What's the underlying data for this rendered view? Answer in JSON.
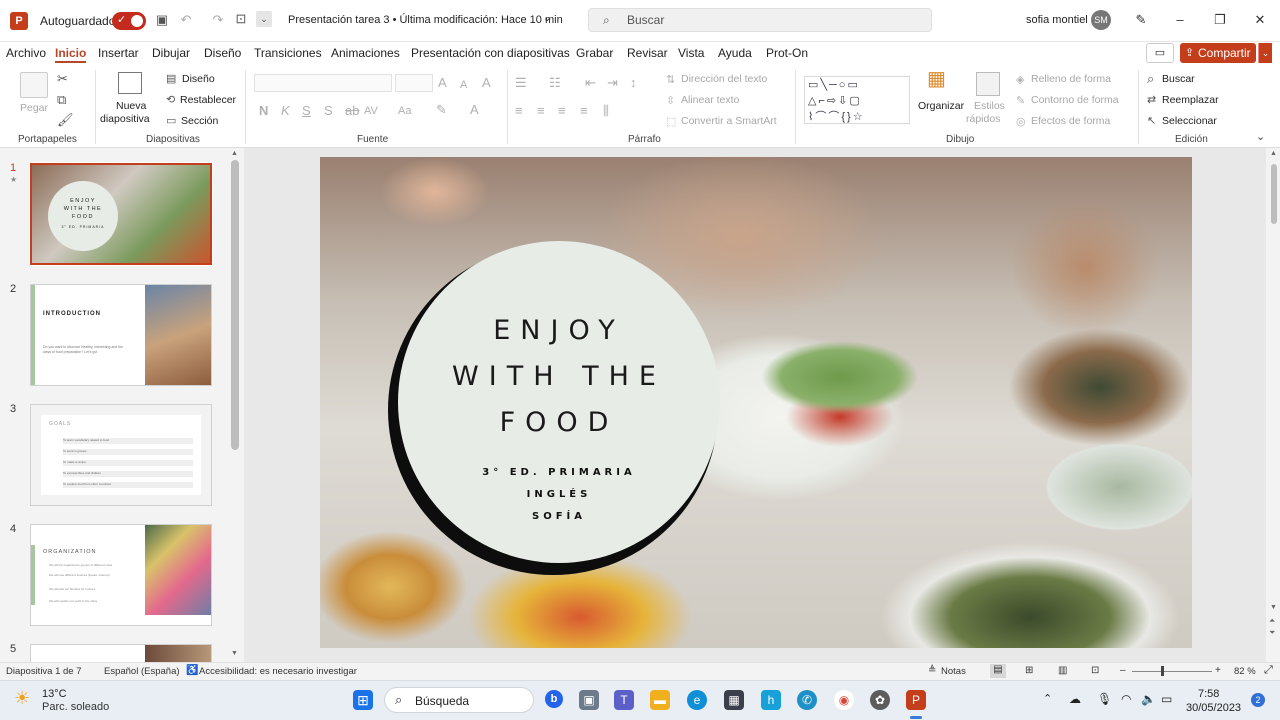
{
  "titlebar": {
    "autosave_label": "Autoguardado",
    "doc_title": "Presentación tarea 3 • Última modificación: Hace 10 min",
    "search_placeholder": "Buscar",
    "user_name": "sofia montiel",
    "user_initials": "SM"
  },
  "menu": {
    "tabs": [
      "Archivo",
      "Inicio",
      "Insertar",
      "Dibujar",
      "Diseño",
      "Transiciones",
      "Animaciones",
      "Presentación con diapositivas",
      "Grabar",
      "Revisar",
      "Vista",
      "Ayuda",
      "Prot-On"
    ],
    "share_label": "Compartir"
  },
  "ribbon": {
    "portapapeles": {
      "label": "Portapapeles",
      "paste": "Pegar"
    },
    "diapositivas": {
      "label": "Diapositivas",
      "new_slide_1": "Nueva",
      "new_slide_2": "diapositiva",
      "diseno": "Diseño",
      "restablecer": "Restablecer",
      "seccion": "Sección"
    },
    "fuente": {
      "label": "Fuente",
      "b": "N",
      "i": "K",
      "u": "S",
      "s": "S",
      "spacing": "AV",
      "case": "Aa",
      "grow": "A",
      "shrink": "A",
      "clear": "A"
    },
    "parrafo": {
      "label": "Párrafo",
      "direccion": "Dirección del texto",
      "alinear": "Alinear texto",
      "smartart": "Convertir a SmartArt"
    },
    "dibujo": {
      "label": "Dibujo",
      "organizar": "Organizar",
      "estilos_1": "Estilos",
      "estilos_2": "rápidos",
      "relleno": "Relleno de forma",
      "contorno": "Contorno de forma",
      "efectos": "Efectos de forma"
    },
    "edicion": {
      "label": "Edición",
      "buscar": "Buscar",
      "reemplazar": "Reemplazar",
      "seleccionar": "Seleccionar"
    }
  },
  "thumbnails": [
    {
      "number": "1",
      "title_lines": [
        "ENJOY",
        "WITH THE",
        "FOOD"
      ],
      "sub": "3° ED. PRIMARIA"
    },
    {
      "number": "2",
      "title": "INTRODUCTION",
      "body": "Do you want to discover healthy, interesting and fun ways of food preparation? Let's go!"
    },
    {
      "number": "3",
      "title": "GOALS",
      "items": [
        "To learn vocabulary related to food",
        "To work in groups",
        "To make a recipe",
        "To express likes and dislikes",
        "To explore food from other countries"
      ]
    },
    {
      "number": "4",
      "title": "ORGANIZATION",
      "items": [
        "We will be organized in groups of different roles",
        "We will use different sources (books, internet)",
        "We will ask our families for recipes",
        "We will explain our work to the class"
      ]
    },
    {
      "number": "5"
    }
  ],
  "slide": {
    "title_lines": [
      "ENJOY",
      "WITH THE",
      "FOOD"
    ],
    "subtitle_lines": [
      "3° ED. PRIMARIA",
      "INGLÉS",
      "SOFÍA"
    ]
  },
  "status": {
    "slide_info": "Diapositiva 1 de 7",
    "language": "Español (España)",
    "accessibility": "Accesibilidad: es necesario investigar",
    "notes": "Notas",
    "zoom": "82 %"
  },
  "taskbar": {
    "temperature": "13°C",
    "weather": "Parc. soleado",
    "search_label": "Búsqueda",
    "time": "7:58",
    "date": "30/05/2023",
    "notification_count": "2"
  },
  "colors": {
    "accent": "#c43e1c",
    "active_tab": "#b7472a"
  }
}
